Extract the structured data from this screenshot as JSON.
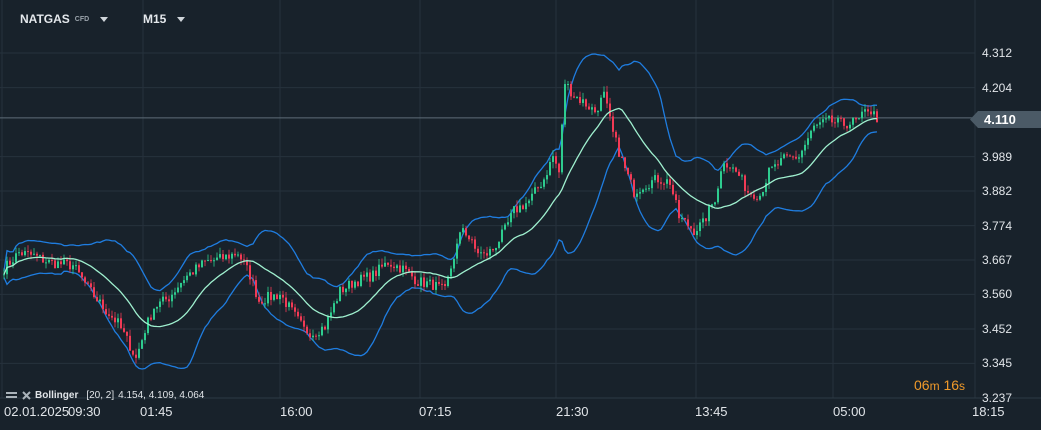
{
  "header": {
    "symbol": "NATGAS",
    "symbol_type": "CFD",
    "timeframe": "M15"
  },
  "current_price": "4.110",
  "timer": {
    "minutes": "06",
    "m": "m",
    "seconds": "16",
    "s": "s"
  },
  "indicator": {
    "name": "Bollinger",
    "params": "[20, 2]",
    "values": "4.154,  4.109,  4.064"
  },
  "colors": {
    "up": "#2ecc8f",
    "down": "#f23a55",
    "bands": "#1f7de0",
    "sma": "#9ff0cf",
    "grid": "#26323c",
    "background": "#18222b"
  },
  "chart_data": {
    "type": "candlestick",
    "y_ticks": [
      "4.312",
      "4.204",
      "4.110",
      "3.989",
      "3.882",
      "3.774",
      "3.667",
      "3.560",
      "3.452",
      "3.345",
      "3.237"
    ],
    "ylim": [
      3.237,
      4.312
    ],
    "x_ticks": [
      "02.01.2025",
      "09:30",
      "01:45",
      "16:00",
      "07:15",
      "21:30",
      "13:45",
      "05:00",
      "18:15"
    ],
    "close_path": [
      [
        0,
        3.64
      ],
      [
        5,
        3.69
      ],
      [
        10,
        3.68
      ],
      [
        15,
        3.66
      ],
      [
        23,
        3.65
      ],
      [
        28,
        3.58
      ],
      [
        33,
        3.52
      ],
      [
        38,
        3.47
      ],
      [
        42,
        3.4
      ],
      [
        44,
        3.36
      ],
      [
        47,
        3.45
      ],
      [
        50,
        3.52
      ],
      [
        55,
        3.55
      ],
      [
        60,
        3.61
      ],
      [
        67,
        3.66
      ],
      [
        72,
        3.67
      ],
      [
        78,
        3.69
      ],
      [
        82,
        3.62
      ],
      [
        85,
        3.54
      ],
      [
        88,
        3.55
      ],
      [
        92,
        3.56
      ],
      [
        95,
        3.52
      ],
      [
        100,
        3.45
      ],
      [
        103,
        3.44
      ],
      [
        107,
        3.46
      ],
      [
        112,
        3.57
      ],
      [
        117,
        3.6
      ],
      [
        123,
        3.62
      ],
      [
        128,
        3.66
      ],
      [
        133,
        3.64
      ],
      [
        138,
        3.6
      ],
      [
        143,
        3.59
      ],
      [
        147,
        3.57
      ],
      [
        150,
        3.68
      ],
      [
        153,
        3.77
      ],
      [
        157,
        3.7
      ],
      [
        160,
        3.68
      ],
      [
        163,
        3.7
      ],
      [
        167,
        3.76
      ],
      [
        170,
        3.82
      ],
      [
        175,
        3.85
      ],
      [
        180,
        3.92
      ],
      [
        183,
        3.99
      ],
      [
        185,
        3.94
      ],
      [
        187,
        4.22
      ],
      [
        190,
        4.18
      ],
      [
        193,
        4.16
      ],
      [
        197,
        4.13
      ],
      [
        200,
        4.18
      ],
      [
        203,
        4.06
      ],
      [
        207,
        3.95
      ],
      [
        210,
        3.88
      ],
      [
        213,
        3.9
      ],
      [
        218,
        3.92
      ],
      [
        222,
        3.91
      ],
      [
        225,
        3.8
      ],
      [
        230,
        3.76
      ],
      [
        233,
        3.78
      ],
      [
        237,
        3.86
      ],
      [
        240,
        3.98
      ],
      [
        245,
        3.93
      ],
      [
        248,
        3.88
      ],
      [
        252,
        3.87
      ],
      [
        255,
        3.94
      ],
      [
        260,
        3.98
      ],
      [
        265,
        3.99
      ],
      [
        270,
        4.08
      ],
      [
        275,
        4.1
      ],
      [
        280,
        4.09
      ],
      [
        285,
        4.1
      ],
      [
        288,
        4.14
      ],
      [
        291,
        4.11
      ]
    ]
  }
}
